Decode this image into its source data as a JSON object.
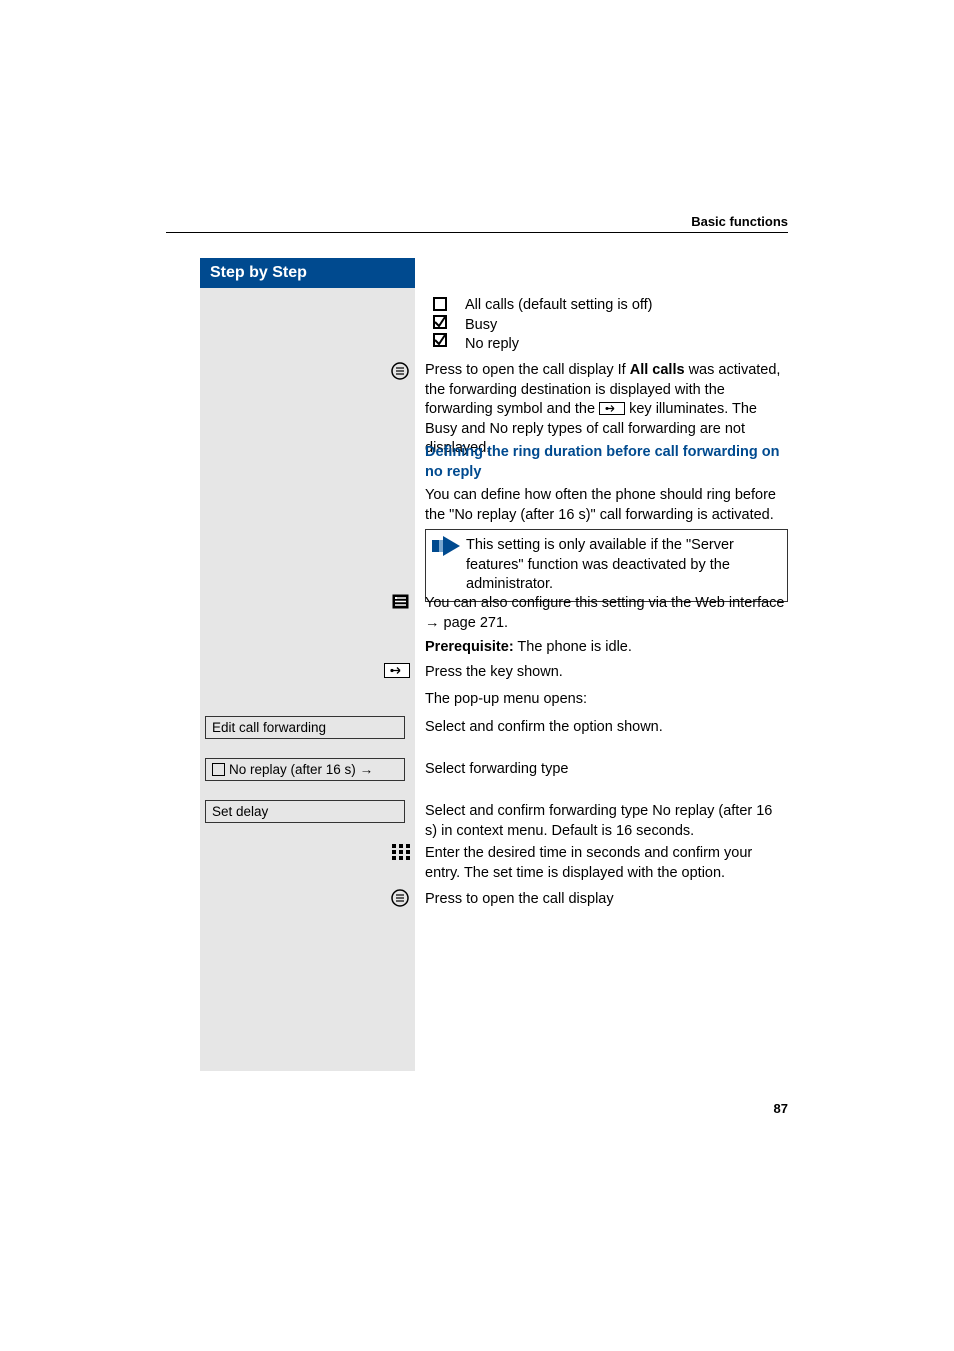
{
  "header": {
    "section_title": "Basic functions"
  },
  "sidebar": {
    "title": "Step by Step",
    "ui_boxes": {
      "edit_call_forwarding": "Edit call forwarding",
      "no_replay_after": "No replay (after 16 s)",
      "set_delay": "Set delay"
    }
  },
  "content": {
    "checklist": {
      "items": [
        {
          "checked": false,
          "label": "All calls (default setting is off)"
        },
        {
          "checked": true,
          "label": "Busy"
        },
        {
          "checked": true,
          "label": "No reply"
        }
      ]
    },
    "press_open_1a": "Press to open the call display If ",
    "press_open_1_bold": "All calls",
    "press_open_1b": " was activated, the forwarding destination is displayed with the forwarding symbol and the ",
    "press_open_1c": " key illuminates. The Busy and No reply types of call forwarding are not displayed.",
    "headline_ring": "Defining the ring duration before call forwarding on no reply",
    "ring_body": "You can define how often the phone should ring before the \"No replay (after 16 s)\" call forwarding is activated.",
    "note_text": "This setting is only available if the \"Server features\" function was deactivated by the administrator.",
    "web_if_a": "You can also configure this setting via the Web interface ",
    "web_if_arrow": "→",
    "web_if_b": " page 271.",
    "prereq_label": "Prerequisite:",
    "prereq_text": " The phone is idle.",
    "press_key": "Press the key shown.",
    "popup_opens": "The pop-up menu opens:",
    "select_confirm_option": "Select and confirm the option shown.",
    "select_fwd_type": "Select forwarding type",
    "select_confirm_no_replay": "Select and confirm forwarding type No replay (after 16 s) in context menu. Default is 16 seconds.",
    "enter_time": "Enter the desired time in seconds and confirm your entry. The set time is displayed with the option.",
    "press_open_2": "Press to open the call display"
  },
  "footer": {
    "page_number": "87"
  }
}
